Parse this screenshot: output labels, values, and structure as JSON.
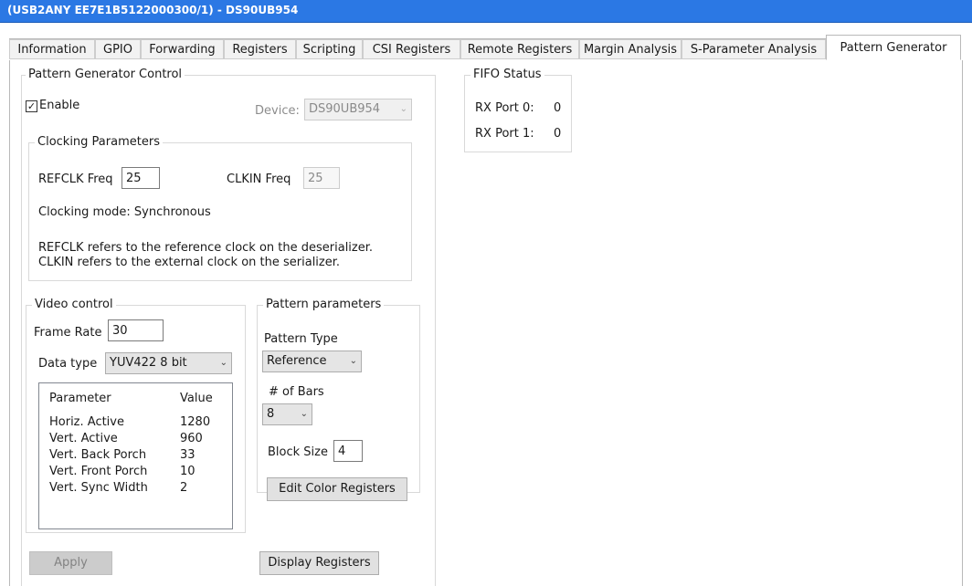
{
  "window": {
    "title": "(USB2ANY EE7E1B5122000300/1) - DS90UB954"
  },
  "tabs": [
    {
      "label": "Information"
    },
    {
      "label": "GPIO"
    },
    {
      "label": "Forwarding"
    },
    {
      "label": "Registers"
    },
    {
      "label": "Scripting"
    },
    {
      "label": "CSI Registers"
    },
    {
      "label": "Remote Registers"
    },
    {
      "label": "Margin Analysis"
    },
    {
      "label": "S-Parameter Analysis"
    },
    {
      "label": "Pattern Generator"
    }
  ],
  "pgc": {
    "title": "Pattern Generator Control",
    "enable_label": "Enable",
    "enable_checked": true,
    "device_label": "Device:",
    "device_value": "DS90UB954"
  },
  "clocking": {
    "title": "Clocking Parameters",
    "refclk_label": "REFCLK Freq",
    "refclk_value": "25",
    "clkin_label": "CLKIN Freq",
    "clkin_value": "25",
    "mode_text": "Clocking mode: Synchronous",
    "note_line1": "REFCLK refers to the reference clock on the deserializer.",
    "note_line2": "CLKIN refers to the external clock on the serializer."
  },
  "video": {
    "title": "Video control",
    "frame_rate_label": "Frame Rate",
    "frame_rate_value": "30",
    "data_type_label": "Data type",
    "data_type_value": "YUV422 8 bit",
    "table": {
      "headers": [
        "Parameter",
        "Value"
      ],
      "rows": [
        [
          "Horiz. Active",
          "1280"
        ],
        [
          "Vert. Active",
          "960"
        ],
        [
          "Vert. Back Porch",
          "33"
        ],
        [
          "Vert. Front Porch",
          "10"
        ],
        [
          "Vert. Sync Width",
          "2"
        ]
      ]
    }
  },
  "pattern": {
    "title": "Pattern parameters",
    "type_label": "Pattern Type",
    "type_value": "Reference",
    "bars_label": "# of Bars",
    "bars_value": "8",
    "block_size_label": "Block Size",
    "block_size_value": "4",
    "edit_color_label": "Edit Color Registers"
  },
  "buttons": {
    "apply_label": "Apply",
    "display_registers_label": "Display Registers"
  },
  "fifo": {
    "title": "FIFO Status",
    "ports": [
      {
        "label": "RX Port 0:",
        "value": "0"
      },
      {
        "label": "RX Port 1:",
        "value": "0"
      }
    ]
  }
}
